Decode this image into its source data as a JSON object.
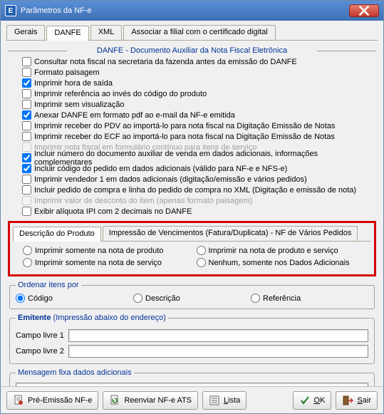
{
  "window": {
    "title": "Parâmetros da NF-e",
    "app_icon_letter": "E"
  },
  "tabs": {
    "t0": "Gerais",
    "t1": "DANFE",
    "t2": "XML",
    "t3": "Associar a filial com o certificado digital",
    "active": 1
  },
  "section_header": "DANFE - Documento Auxiliar da Nota Fiscal Eletrônica",
  "checks": [
    {
      "label": "Consultar nota fiscal na secretaria da fazenda antes da emissão do DANFE",
      "checked": false,
      "disabled": false
    },
    {
      "label": "Formato paisagem",
      "checked": false,
      "disabled": false
    },
    {
      "label": "Imprimir hora de saída",
      "checked": true,
      "disabled": false
    },
    {
      "label": "Imprimir referência ao invés do código do produto",
      "checked": false,
      "disabled": false
    },
    {
      "label": "Imprimir sem visualização",
      "checked": false,
      "disabled": false
    },
    {
      "label": "Anexar DANFE em formato pdf ao e-mail da NF-e emitida",
      "checked": true,
      "disabled": false
    },
    {
      "label": "Imprimir receber do PDV ao importá-lo para nota fiscal na Digitação Emissão de Notas",
      "checked": false,
      "disabled": false
    },
    {
      "label": "Imprimir receber do ECF ao importá-lo para nota fiscal na Digitação Emissão de Notas",
      "checked": false,
      "disabled": false
    },
    {
      "label": "Imprimir nota fiscal em formulário contínuo para itens de serviço",
      "checked": false,
      "disabled": true
    },
    {
      "label": "Incluir número do documento auxiliar de venda em dados adicionais, informações complementares",
      "checked": true,
      "disabled": false
    },
    {
      "label": "Incluir código do pedido em dados adicionais (válido para NF-e e NFS-e)",
      "checked": true,
      "disabled": false
    },
    {
      "label": "Imprimir vendedor 1 em dados adicionais (digitação/emissão e vários pedidos)",
      "checked": false,
      "disabled": false
    },
    {
      "label": "Incluir pedido de compra e linha do pedido de compra no XML (Digitação e emissão de nota)",
      "checked": false,
      "disabled": false
    },
    {
      "label": "Imprimir valor de desconto do item (apenas formato paisagem)",
      "checked": false,
      "disabled": true
    },
    {
      "label": "Exibir alíquota IPI com 2 decimais no DANFE",
      "checked": false,
      "disabled": false
    }
  ],
  "inner_tabs": {
    "t0": "Descrição do Produto",
    "t1": "Impressão de Vencimentos (Fatura/Duplicata) - NF de Vários Pedidos",
    "active": 0
  },
  "print_options": {
    "o0": "Imprimir somente na nota de produto",
    "o1": "Imprimir na nota de produto e serviço",
    "o2": "Imprimir somente na nota de serviço",
    "o3": "Nenhum, somente nos Dados Adicionais"
  },
  "order_by": {
    "legend": "Ordenar itens por",
    "o0": "Código",
    "o1": "Descrição",
    "o2": "Referência",
    "selected": 0
  },
  "emitente": {
    "legend_bold": "Emitente",
    "legend_note": " (Impressão abaixo do endereço)",
    "f1_label": "Campo livre 1",
    "f1_value": "",
    "f2_label": "Campo livre 2",
    "f2_value": ""
  },
  "msg": {
    "legend": "Mensagem fixa dados adicionais",
    "value": ""
  },
  "footer": {
    "b_pre": "Pré-Emissão NF-e",
    "b_reenviar": "Reenviar NF-e ATS",
    "b_lista": "Lista",
    "b_ok": "OK",
    "b_sair": "Sair"
  }
}
